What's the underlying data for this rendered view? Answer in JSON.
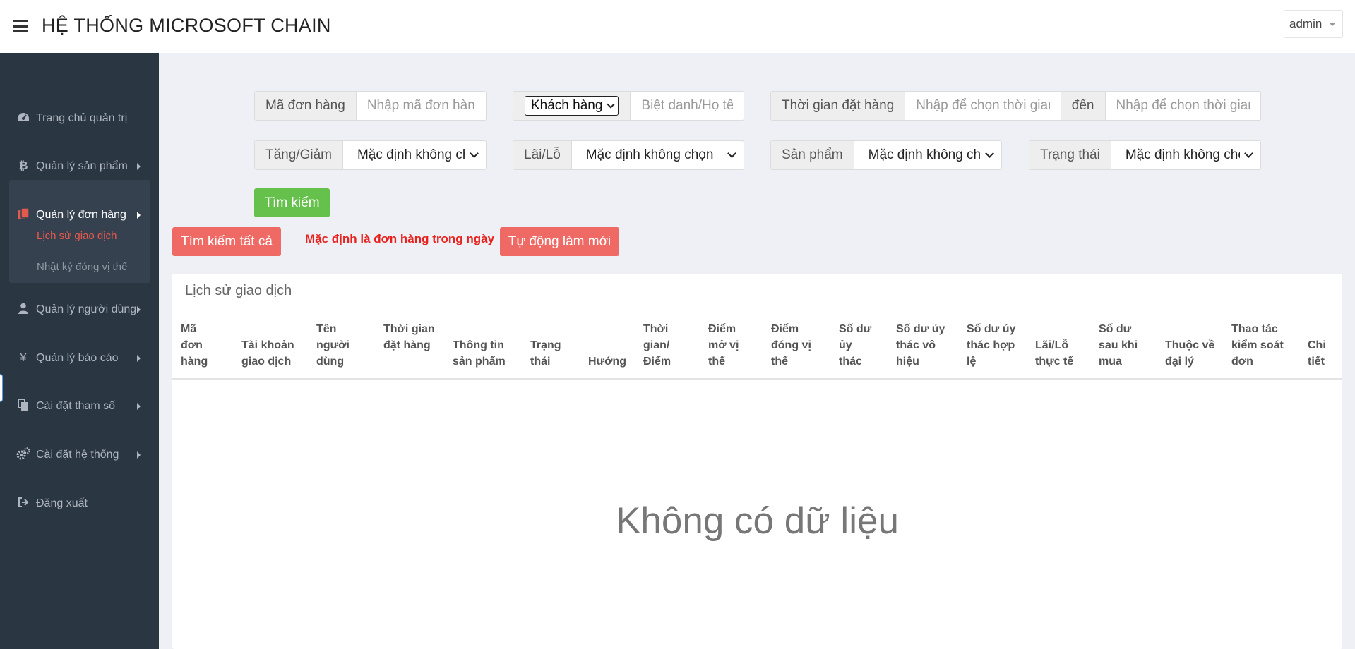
{
  "header": {
    "title": "HỆ THỐNG MICROSOFT CHAIN",
    "user": "admin"
  },
  "sidebar": {
    "items": [
      {
        "label": "Trang chủ quản trị",
        "icon": "dashboard-icon"
      },
      {
        "label": "Quản lý sản phẩm",
        "icon": "bitcoin-icon"
      },
      {
        "label": "Quản lý đơn hàng",
        "icon": "orders-icon"
      },
      {
        "label": "Quản lý người dùng",
        "icon": "user-icon"
      },
      {
        "label": "Quản lý báo cáo",
        "icon": "yen-icon"
      },
      {
        "label": "Cài đặt tham số",
        "icon": "copy-icon"
      },
      {
        "label": "Cài đặt hệ thống",
        "icon": "gears-icon"
      },
      {
        "label": "Đăng xuất",
        "icon": "sign-out-icon"
      }
    ],
    "sub_items": [
      {
        "label": "Lịch sử giao dịch"
      },
      {
        "label": "Nhật ký đóng vị thế"
      }
    ],
    "accent_color": "#e8594c"
  },
  "filters": {
    "order_id": {
      "label": "Mã đơn hàng",
      "placeholder": "Nhập mã đơn hàng"
    },
    "customer": {
      "select_value": "Khách hàng",
      "placeholder": "Biệt danh/Họ tên"
    },
    "order_time": {
      "label": "Thời gian đặt hàng",
      "placeholder": "Nhập để chọn thời gian",
      "to_label": "đến",
      "to_placeholder": "Nhập để chọn thời gian"
    },
    "direction": {
      "label": "Tăng/Giảm",
      "value": "Mặc định không chọn"
    },
    "pnl": {
      "label": "Lãi/Lỗ",
      "value": "Mặc định không chọn"
    },
    "product": {
      "label": "Sản phẩm",
      "value": "Mặc định không chọn"
    },
    "status": {
      "label": "Trạng thái",
      "value": "Mặc định không chọn"
    }
  },
  "actions": {
    "search": "Tìm kiếm",
    "search_all": "Tìm kiếm tất cả",
    "default_notice": "Mặc định là đơn hàng trong ngày",
    "auto_refresh": "Tự động làm mới"
  },
  "table": {
    "title": "Lịch sử giao dịch",
    "columns": [
      "Mã đơn hàng",
      "Tài khoản giao dịch",
      "Tên người dùng",
      "Thời gian đặt hàng",
      "Thông tin sản phẩm",
      "Trạng thái",
      "Hướng",
      "Thời gian/ Điểm",
      "Điểm mở vị thế",
      "Điểm đóng vị thế",
      "Số dư ủy thác",
      "Số dư ủy thác vô hiệu",
      "Số dư ủy thác hợp lệ",
      "Lãi/Lỗ thực tế",
      "Số dư sau khi mua",
      "Thuộc về đại lý",
      "Thao tác kiểm soát đơn",
      "Chi tiết"
    ],
    "empty_text": "Không có dữ liệu"
  }
}
